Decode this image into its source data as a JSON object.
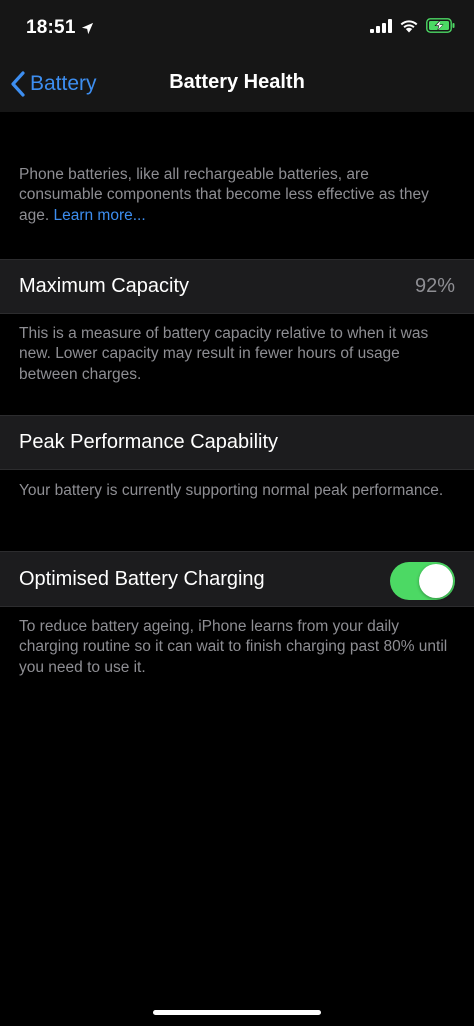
{
  "status_bar": {
    "time": "18:51",
    "icons": [
      "location-arrow-icon",
      "cellular-signal-icon",
      "wifi-icon",
      "battery-charging-icon"
    ],
    "battery_color": "#4cd964"
  },
  "nav": {
    "back_label": "Battery",
    "title": "Battery Health"
  },
  "intro": {
    "text": "Phone batteries, like all rechargeable batteries, are consumable components that become less effective as they age. ",
    "link": "Learn more..."
  },
  "max_capacity": {
    "label": "Maximum Capacity",
    "value": "92%",
    "footer": "This is a measure of battery capacity relative to when it was new. Lower capacity may result in fewer hours of usage between charges."
  },
  "peak_performance": {
    "label": "Peak Performance Capability",
    "footer": "Your battery is currently supporting normal peak performance."
  },
  "optimised_charging": {
    "label": "Optimised Battery Charging",
    "enabled": true,
    "footer": "To reduce battery ageing, iPhone learns from your daily charging routine so it can wait to finish charging past 80% until you need to use it."
  },
  "colors": {
    "accent": "#3d8ef0",
    "toggle_on": "#4cd964",
    "background": "#000000",
    "cell": "#1c1c1e",
    "secondary_text": "#8e8e93"
  }
}
